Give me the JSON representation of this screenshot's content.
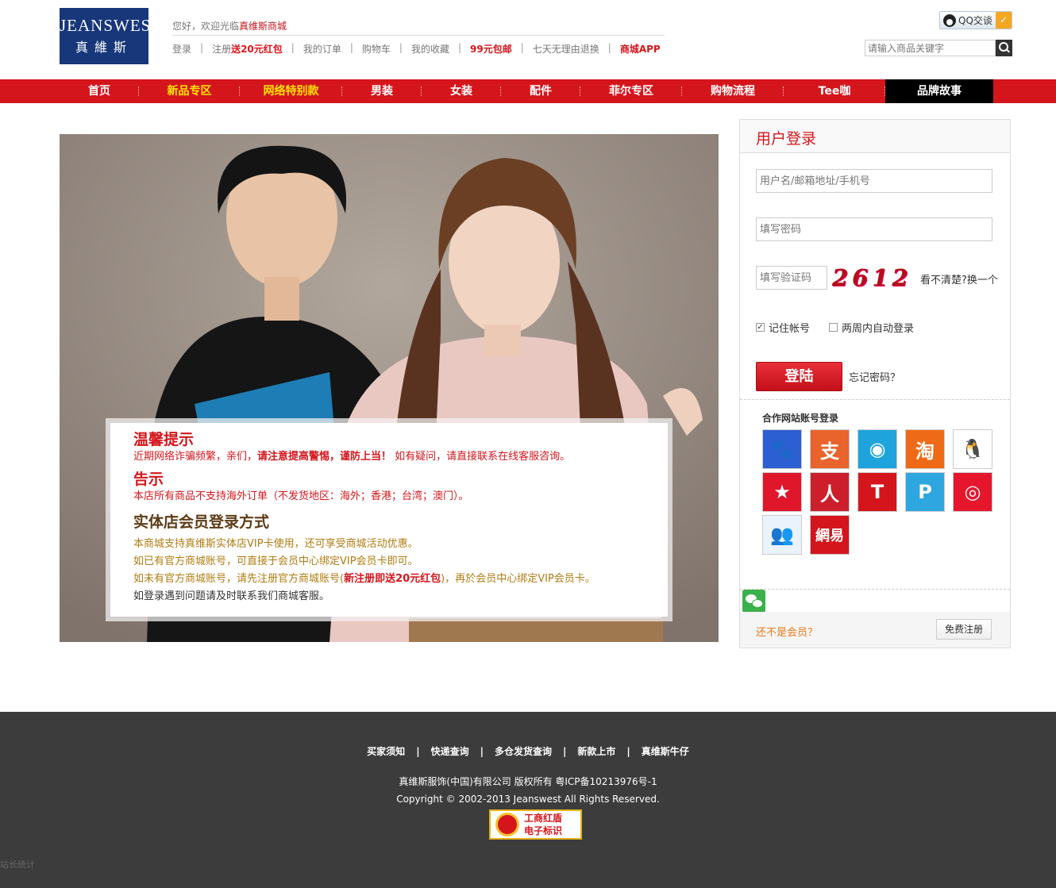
{
  "header": {
    "logo_en": "JEANSWEST",
    "logo_cn": "真維斯",
    "welcome_prefix": "您好，欢迎光临",
    "welcome_site": "真维斯商城",
    "links": [
      {
        "prefix": "登录",
        "emph": ""
      },
      {
        "prefix": "注册",
        "emph": "送20元红包"
      },
      {
        "prefix": "我的订单",
        "emph": ""
      },
      {
        "prefix": "购物车",
        "emph": ""
      },
      {
        "prefix": "我的收藏",
        "emph": ""
      },
      {
        "prefix": "",
        "emph": "99元包邮"
      },
      {
        "prefix": "七天无理由退换",
        "emph": ""
      },
      {
        "prefix": "",
        "emph": "商城APP"
      }
    ],
    "qq_label": "QQ交谈",
    "search_placeholder": "请输入商品关键字"
  },
  "nav": [
    {
      "label": "首页",
      "style": "normal",
      "w": 100
    },
    {
      "label": "新品专区",
      "style": "yellow",
      "w": 127
    },
    {
      "label": "网络特别款",
      "style": "yellow",
      "w": 129
    },
    {
      "label": "男装",
      "style": "normal",
      "w": 100
    },
    {
      "label": "女装",
      "style": "normal",
      "w": 100
    },
    {
      "label": "配件",
      "style": "normal",
      "w": 100
    },
    {
      "label": "菲尔专区",
      "style": "normal",
      "w": 128
    },
    {
      "label": "购物流程",
      "style": "normal",
      "w": 128
    },
    {
      "label": "Tee咖",
      "style": "normal",
      "w": 128
    },
    {
      "label": "品牌故事",
      "style": "dark",
      "w": 136
    }
  ],
  "notice": {
    "h1": "温馨提示",
    "p1_a": "近期网络诈骗频繁，亲们，",
    "p1_b": "请注意提高警惕，谨防上当！",
    "p1_c": " 如有疑问，请直接联系在线客服咨询。",
    "h2": "告示",
    "p2": "本店所有商品不支持海外订单（不发货地区：海外；香港；台湾；澳门）。",
    "h3": "实体店会员登录方式",
    "p3": "本商城支持真维斯实体店VIP卡使用，还可享受商城活动优惠。",
    "p4": "如已有官方商城账号，可直接于会员中心绑定VIP会员卡即可。",
    "p5_a": "如未有官方商城账号，请先注册官方商城账号(",
    "p5_b": "新注册即送20元红包",
    "p5_c": ")，再於会员中心绑定VIP会员卡。",
    "p6": "如登录遇到问题请及时联系我们商城客服。"
  },
  "login": {
    "title": "用户登录",
    "username_placeholder": "用户名/邮箱地址/手机号",
    "password_placeholder": "填写密码",
    "captcha_placeholder": "填写验证码",
    "captcha_code": "2612",
    "captcha_refresh": "看不清楚?换一个",
    "remember": "记住帐号",
    "remember_checked": true,
    "auto_login": "两周内自动登录",
    "auto_checked": false,
    "submit": "登陆",
    "forgot": "忘记密码？",
    "partner_title": "合作网站账号登录",
    "partners": [
      {
        "name": "baidu",
        "bg": "#2c5fd1",
        "glyph": "🐾"
      },
      {
        "name": "alipay",
        "bg": "#e8642c",
        "glyph": "支"
      },
      {
        "name": "sina-ask",
        "bg": "#1fa3dc",
        "glyph": "◉"
      },
      {
        "name": "taobao",
        "bg": "#ef6a16",
        "glyph": "淘"
      },
      {
        "name": "qq",
        "bg": "#ffffff",
        "glyph": "🐧"
      },
      {
        "name": "kaixin",
        "bg": "#e0162b",
        "glyph": "★"
      },
      {
        "name": "renren",
        "bg": "#cc1f2b",
        "glyph": "人"
      },
      {
        "name": "tianya",
        "bg": "#d4161c",
        "glyph": "T"
      },
      {
        "name": "tencent-weibo",
        "bg": "#2ea7e0",
        "glyph": "P"
      },
      {
        "name": "sina-weibo",
        "bg": "#e6162d",
        "glyph": "◎"
      },
      {
        "name": "msn",
        "bg": "#eaf3fb",
        "glyph": "👥"
      },
      {
        "name": "netease",
        "bg": "#d4161c",
        "glyph": "網易"
      }
    ],
    "not_member": "还不是会员？",
    "register": "免费注册"
  },
  "footer": {
    "links": [
      "买家须知",
      "快递查询",
      "多仓发货查询",
      "新款上市",
      "真维斯牛仔"
    ],
    "copyright_cn": "真维斯服饰(中国)有限公司 版权所有 粤ICP备10213976号-1",
    "copyright_en": "Copyright © 2002-2013 Jeanswest All Rights Reserved.",
    "badge_l1": "工商红盾",
    "badge_l2": "电子标识",
    "stat": "站长统计"
  },
  "colors": {
    "brand_red": "#d4161c",
    "nav_yellow": "#ffe400",
    "logo_blue": "#17377a",
    "footer_bg": "#3c3c3c"
  }
}
